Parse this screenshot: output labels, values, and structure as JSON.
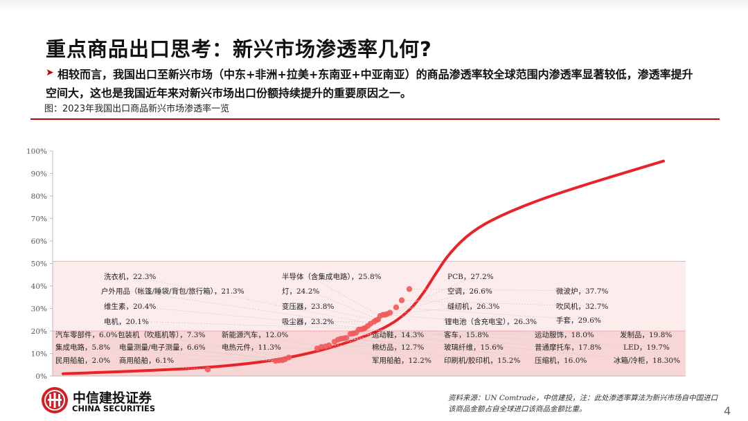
{
  "page": {
    "title": "重点商品出口思考：新兴市场渗透率几何?",
    "bullet_marker": "➤",
    "bullet": "相较而言，我国出口至新兴市场（中东+非洲+拉美+东南亚+中亚南亚）的商品渗透率较全球范围内渗透率显著较低，渗透率提升空间大，这也是我国近年来对新兴市场出口份额持续提升的重要原因之一。",
    "figure_caption": "图：2023年我国出口商品新兴市场渗透率一览",
    "source": "资料来源：UN Comtrade，中信建投，注：此处渗透率算法为新兴市场自中国进口该商品金额占自全球进口该商品金额比重。",
    "page_number": "4",
    "logo": {
      "cn": "中信建投证券",
      "en": "CHINA SECURITIES",
      "icon": "citic-seal-icon"
    }
  },
  "chart_data": {
    "type": "scatter",
    "y_ticks": [
      "0%",
      "10%",
      "20%",
      "30%",
      "40%",
      "50%",
      "60%",
      "70%",
      "80%",
      "90%",
      "100%"
    ],
    "ylim": [
      0,
      100
    ],
    "colors": {
      "curve": "#e8232a",
      "points": "#ef5a5a",
      "band_upper": "#fdecec",
      "band_lower": "#f8d6d6",
      "leader": "#cccccc",
      "grid": "#e6e6e6"
    },
    "band_boundaries": [
      20,
      51
    ],
    "points": [
      {
        "label": "民用船舶",
        "value": 2.0
      },
      {
        "label": "集成电路",
        "value": 5.8
      },
      {
        "label": "汽车零部件",
        "value": 6.0
      },
      {
        "label": "商用船舶",
        "value": 6.1
      },
      {
        "label": "电量测量/电子测量",
        "value": 6.6
      },
      {
        "label": "包装机（吹瓶机等）",
        "value": 7.3
      },
      {
        "label": "电热元件",
        "value": 11.3
      },
      {
        "label": "新能源汽车",
        "value": 12.0
      },
      {
        "label": "军用船舶",
        "value": 12.2
      },
      {
        "label": "棉纺品",
        "value": 12.7
      },
      {
        "label": "运动鞋",
        "value": 14.3
      },
      {
        "label": "印刷机/胶印机",
        "value": 15.2
      },
      {
        "label": "玻璃纤维",
        "value": 15.6
      },
      {
        "label": "客车",
        "value": 15.8
      },
      {
        "label": "压缩机",
        "value": 16.0
      },
      {
        "label": "普通摩托车",
        "value": 17.8
      },
      {
        "label": "运动服饰",
        "value": 18.0
      },
      {
        "label": "冰箱/冷柜",
        "value": 18.3,
        "label_text": "冰箱/冷柜，18.30%"
      },
      {
        "label": "LED",
        "value": 19.7
      },
      {
        "label": "发制品",
        "value": 19.8
      },
      {
        "label": "电机",
        "value": 20.1
      },
      {
        "label": "维生素",
        "value": 20.4
      },
      {
        "label": "户外用品（帐篷/睡袋/背包/旅行箱）",
        "value": 21.3
      },
      {
        "label": "洗衣机",
        "value": 22.3
      },
      {
        "label": "吸尘器",
        "value": 23.2
      },
      {
        "label": "变压器",
        "value": 23.8
      },
      {
        "label": "灯",
        "value": 24.2
      },
      {
        "label": "半导体（含集成电路）",
        "value": 25.8
      },
      {
        "label": "缝纫机",
        "value": 26.3
      },
      {
        "label": "锂电池（含充电宝）",
        "value": 26.3
      },
      {
        "label": "空调",
        "value": 26.6
      },
      {
        "label": "PCB",
        "value": 27.2
      },
      {
        "label": "手套",
        "value": 29.6
      },
      {
        "label": "吹风机",
        "value": 32.7
      },
      {
        "label": "微波炉",
        "value": 37.7
      }
    ]
  }
}
